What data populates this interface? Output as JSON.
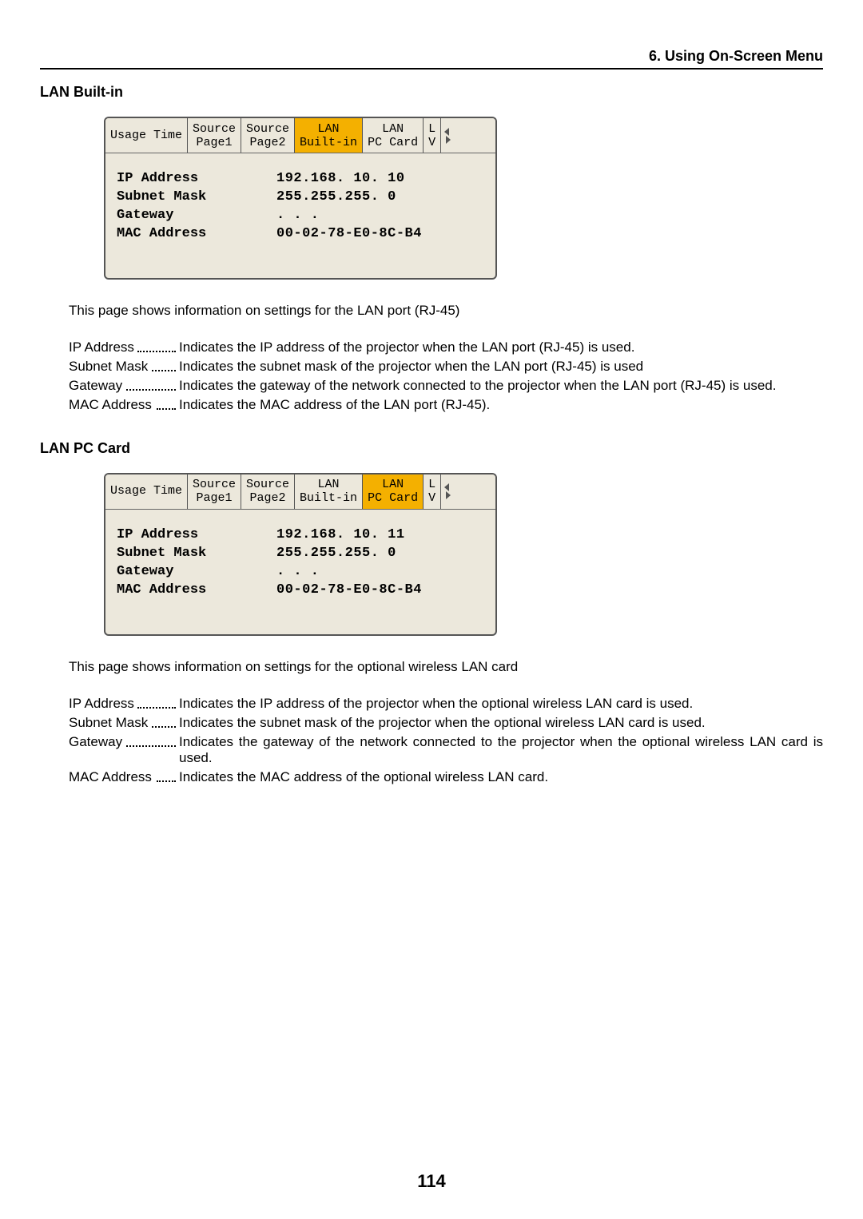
{
  "header": "6. Using On-Screen Menu",
  "page_number": "114",
  "sections": [
    {
      "title": "LAN Built-in",
      "tabs": [
        "Usage Time",
        "Source Page1",
        "Source Page2",
        "LAN Built-in",
        "LAN PC Card",
        "L V"
      ],
      "active_tab_index": 3,
      "rows": [
        {
          "label": "IP Address",
          "value": "192.168. 10. 10"
        },
        {
          "label": "Subnet Mask",
          "value": "255.255.255.  0"
        },
        {
          "label": "Gateway",
          "value": "  .   .   ."
        },
        {
          "label": "MAC Address",
          "value": "00-02-78-E0-8C-B4"
        }
      ],
      "desc": "This page shows information on settings for the LAN port (RJ-45)",
      "defs": [
        {
          "term": "IP Address",
          "def": "Indicates the IP address of the projector when the LAN port (RJ-45) is used."
        },
        {
          "term": "Subnet Mask",
          "def": "Indicates the subnet mask of the projector when the LAN port (RJ-45) is used"
        },
        {
          "term": "Gateway",
          "def": "Indicates the gateway of the network connected to the projector when the LAN port (RJ-45) is used."
        },
        {
          "term": "MAC Address",
          "def": "Indicates the MAC address of the LAN port (RJ-45)."
        }
      ]
    },
    {
      "title": "LAN PC Card",
      "tabs": [
        "Usage Time",
        "Source Page1",
        "Source Page2",
        "LAN Built-in",
        "LAN PC Card",
        "L V"
      ],
      "active_tab_index": 4,
      "rows": [
        {
          "label": "IP Address",
          "value": "192.168. 10. 11"
        },
        {
          "label": "Subnet Mask",
          "value": "255.255.255.  0"
        },
        {
          "label": "Gateway",
          "value": "  .   .   ."
        },
        {
          "label": "MAC Address",
          "value": "00-02-78-E0-8C-B4"
        }
      ],
      "desc": "This page shows information on settings for the optional wireless LAN card",
      "defs": [
        {
          "term": "IP Address",
          "def": "Indicates the IP address of the projector when the optional wireless LAN card is used."
        },
        {
          "term": "Subnet Mask",
          "def": "Indicates the subnet mask of the projector when the optional wireless LAN card is used."
        },
        {
          "term": "Gateway",
          "def": "Indicates the gateway of the network connected to the projector when the optional wireless LAN card is used."
        },
        {
          "term": "MAC Address",
          "def": "Indicates the MAC address of the optional wireless LAN card."
        }
      ]
    }
  ]
}
